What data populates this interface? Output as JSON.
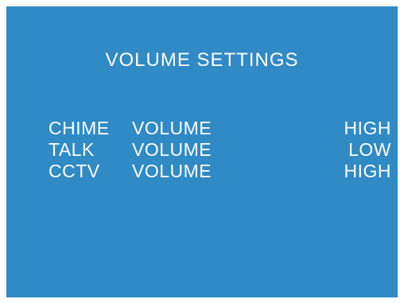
{
  "screen": {
    "background_color": "#2f8ac6",
    "text_color": "#ffffff",
    "title": "VOLUME SETTINGS"
  },
  "settings": [
    {
      "name": "CHIME",
      "label": "VOLUME",
      "value": "HIGH"
    },
    {
      "name": "TALK",
      "label": "VOLUME",
      "value": "LOW"
    },
    {
      "name": "CCTV",
      "label": "VOLUME",
      "value": "HIGH"
    }
  ]
}
